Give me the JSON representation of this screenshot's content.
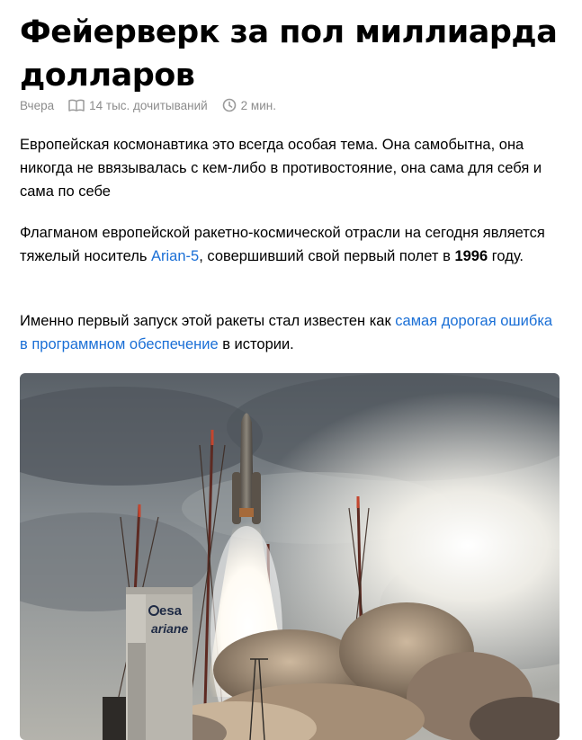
{
  "article": {
    "title": "Фейерверк за пол миллиарда долларов",
    "meta": {
      "date": "Вчера",
      "reads": "14 тыс. дочитываний",
      "read_time": "2 мин."
    },
    "paragraphs": [
      {
        "text": "Европейская космонавтика это всегда особая тема. Она самобытна, она никогда не ввязывалась с кем-либо в противостояние, она сама для себя и сама по себе"
      },
      {
        "before": "Флагманом европейской ракетно-космической отрасли на сегодня является тяжелый носитель ",
        "link": "Arian-5",
        "middle": ", совершивший свой первый полет в ",
        "bold": "1996",
        "after": " году."
      },
      {
        "before": "Именно первый запуск этой ракеты стал известен как ",
        "link": "самая дорогая ошибка в программном обеспечение",
        "after": " в истории."
      }
    ],
    "image": {
      "building_logo_top": "esa",
      "building_logo_bottom": "ariane"
    }
  },
  "colors": {
    "link": "#1a6fd6",
    "meta": "#8c8c8c",
    "text": "#000000"
  },
  "icons": {
    "reads": "open-book-icon",
    "read_time": "clock-icon"
  }
}
